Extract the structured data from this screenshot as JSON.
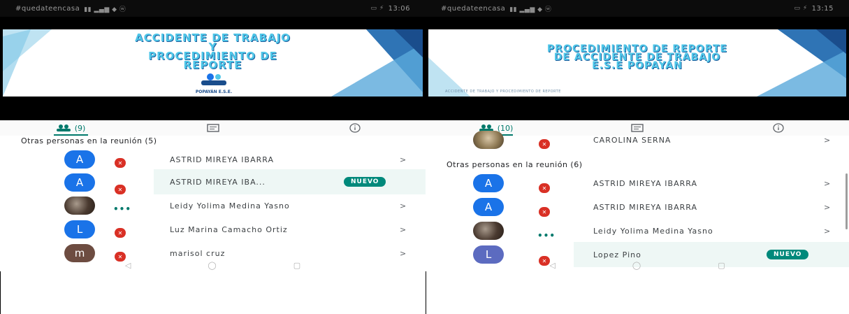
{
  "left": {
    "status": {
      "carrier": "#quedateencasa",
      "time": "13:06"
    },
    "slide": {
      "title_lines": [
        "ACCIDENTE DE TRABAJO",
        "Y",
        "PROCEDIMIENTO DE",
        "REPORTE"
      ],
      "logo_text": "POPAYÁN E.S.E."
    },
    "tabs": {
      "people_count": "(9)"
    },
    "section_title": "Otras personas en la reunión (5)",
    "participants": [
      {
        "initial": "A",
        "name": "ASTRID MIREYA IBARRA",
        "color": "#1a73e8",
        "status": "muted",
        "chevron": ">"
      },
      {
        "initial": "A",
        "name": "ASTRID MIREYA IBA...",
        "color": "#1a73e8",
        "status": "muted",
        "badge": "NUEVO"
      },
      {
        "initial": "",
        "name": "Leidy Yolima Medina Yasno",
        "color": "photo",
        "status": "dots",
        "chevron": ">"
      },
      {
        "initial": "L",
        "name": "Luz Marina Camacho Ortiz",
        "color": "#1a73e8",
        "status": "muted",
        "chevron": ">"
      },
      {
        "initial": "m",
        "name": "marisol cruz",
        "color": "#6d4c41",
        "status": "muted",
        "chevron": ">"
      }
    ]
  },
  "right": {
    "status": {
      "carrier": "#quedateencasa",
      "time": "13:15"
    },
    "slide": {
      "title_lines": [
        "PROCEDIMIENTO DE REPORTE",
        "DE ACCIDENTE DE TRABAJO",
        "E.S.E POPAYÁN"
      ],
      "subtitle": "ACCIDENTE DE TRABAJO Y PROCEDIMIENTO DE REPORTE"
    },
    "tabs": {
      "people_count": "(10)"
    },
    "top_participant": {
      "name": "CAROLINA SERNA",
      "chevron": ">"
    },
    "section_title": "Otras personas en la reunión (6)",
    "participants": [
      {
        "initial": "A",
        "name": "ASTRID MIREYA IBARRA",
        "color": "#1a73e8",
        "status": "muted",
        "chevron": ">"
      },
      {
        "initial": "A",
        "name": "ASTRID MIREYA IBARRA",
        "color": "#1a73e8",
        "status": "muted",
        "chevron": ">"
      },
      {
        "initial": "",
        "name": "Leidy Yolima Medina Yasno",
        "color": "photo",
        "status": "dots",
        "chevron": ">"
      },
      {
        "initial": "L",
        "name": "Lopez Pino",
        "color": "#5c6bc0",
        "status": "muted",
        "badge": "NUEVO"
      }
    ]
  },
  "colors": {
    "accent": "#00796b",
    "mic_muted": "#d93025",
    "badge": "#00897b",
    "avatar_blue": "#1a73e8"
  },
  "icons": {
    "people": "people-icon",
    "chat": "chat-icon",
    "info": "info-icon",
    "mic_off": "mic-off-icon",
    "back": "nav-back-icon",
    "home": "nav-home-icon",
    "recents": "nav-recents-icon"
  }
}
